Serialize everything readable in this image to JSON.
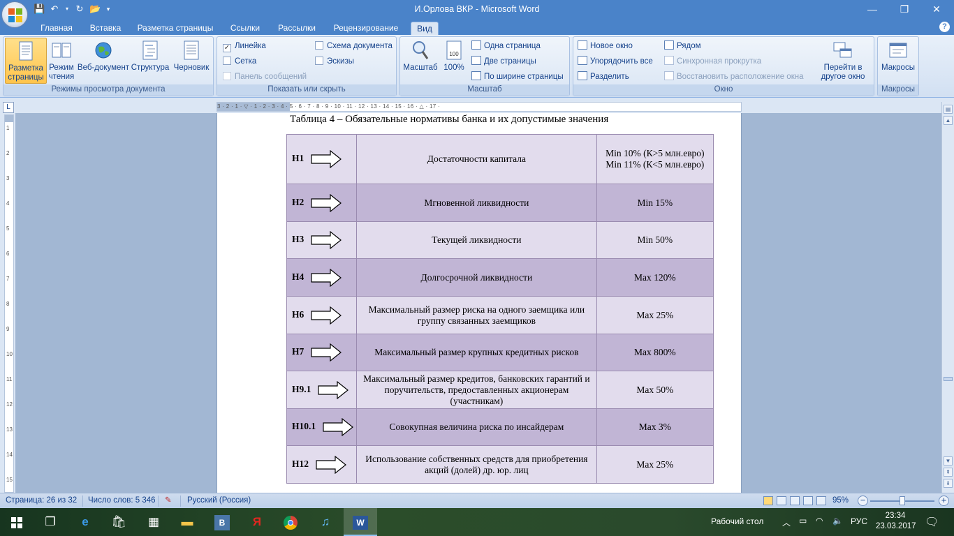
{
  "window": {
    "title": "И.Орлова ВКР - Microsoft Word"
  },
  "ribbon_tabs": [
    "Главная",
    "Вставка",
    "Разметка страницы",
    "Ссылки",
    "Рассылки",
    "Рецензирование",
    "Вид"
  ],
  "active_tab": "Вид",
  "groups": {
    "views": {
      "label": "Режимы просмотра документа",
      "print_layout": "Разметка страницы",
      "reading": "Режим чтения",
      "web": "Веб-документ",
      "outline": "Структура",
      "draft": "Черновик"
    },
    "show_hide": {
      "label": "Показать или скрыть",
      "ruler": "Линейка",
      "ruler_checked": true,
      "grid": "Сетка",
      "grid_checked": false,
      "message_bar": "Панель сообщений",
      "doc_map": "Схема документа",
      "doc_map_checked": false,
      "thumbnails": "Эскизы",
      "thumbnails_checked": false
    },
    "zoom": {
      "label": "Масштаб",
      "zoom_btn": "Масштаб",
      "hundred": "100%",
      "one_page": "Одна страница",
      "two_pages": "Две страницы",
      "page_width": "По ширине страницы"
    },
    "window": {
      "label": "Окно",
      "new_window": "Новое окно",
      "arrange_all": "Упорядочить все",
      "split": "Разделить",
      "side_by_side": "Рядом",
      "sync_scroll": "Синхронная прокрутка",
      "reset_position": "Восстановить расположение окна",
      "switch_windows": "Перейти в другое окно"
    },
    "macros": {
      "label": "Макросы",
      "macros_btn": "Макросы"
    }
  },
  "ruler": {
    "numbers": "3 · 2 · 1 · ▽ · 1 · 2 · 3 · 4 · 5 · 6 · 7 · 8 · 9 · 10 · 11 · 12 · 13 · 14 · 15 · 16 · △ · 17 ·",
    "vertical_numbers": [
      "1",
      "2",
      "3",
      "4",
      "5",
      "6",
      "7",
      "8",
      "9",
      "10",
      "11",
      "12",
      "13",
      "14",
      "15"
    ]
  },
  "document": {
    "caption": "Таблица 4 – Обязательные нормативы банка и их допустимые значения",
    "rows": [
      {
        "code": "Н1",
        "name": "Достаточности капитала",
        "value": "Min 10% (К>5 млн.евро)\nMin 11% (К<5 млн.евро)",
        "shade": "light"
      },
      {
        "code": "Н2",
        "name": "Мгновенной ликвидности",
        "value": "Min 15%",
        "shade": "dark"
      },
      {
        "code": "Н3",
        "name": "Текущей ликвидности",
        "value": "Min 50%",
        "shade": "light"
      },
      {
        "code": "Н4",
        "name": "Долгосрочной ликвидности",
        "value": "Max 120%",
        "shade": "dark"
      },
      {
        "code": "Н6",
        "name": "Максимальный размер риска на одного заемщика или группу связанных заемщиков",
        "value": "Max 25%",
        "shade": "light"
      },
      {
        "code": "Н7",
        "name": "Максимальный размер крупных кредитных рисков",
        "value": "Max 800%",
        "shade": "dark"
      },
      {
        "code": "Н9.1",
        "name": "Максимальный размер кредитов, банковских гарантий и поручительств, предоставленных акционерам (участникам)",
        "value": "Max 50%",
        "shade": "light"
      },
      {
        "code": "Н10.1",
        "name": "Совокупная величина риска по инсайдерам",
        "value": "Max 3%",
        "shade": "dark"
      },
      {
        "code": "Н12",
        "name": "Использование собственных средств для приобретения акций (долей) др. юр. лиц",
        "value": "Max 25%",
        "shade": "light"
      }
    ]
  },
  "status": {
    "page": "Страница: 26 из 32",
    "words": "Число слов: 5 346",
    "language": "Русский (Россия)",
    "zoom": "95%"
  },
  "taskbar": {
    "desktop": "Рабочий стол",
    "lang": "РУС",
    "time": "23:34",
    "date": "23.03.2017",
    "apps": [
      "start-icon",
      "task-view-icon",
      "edge-icon",
      "store-icon",
      "calculator-icon",
      "explorer-icon",
      "vk-icon",
      "yandex-icon",
      "chrome-icon",
      "music-icon",
      "word-icon"
    ]
  },
  "colors": {
    "title_bar": "#4a83c9",
    "row_light": "#e2dced",
    "row_dark": "#c1b5d5",
    "taskbar": "#1a3a24"
  }
}
